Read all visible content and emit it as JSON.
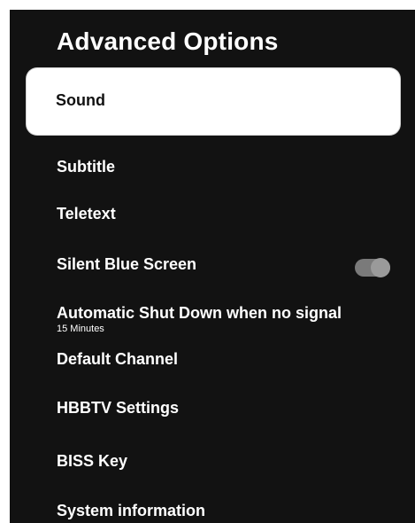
{
  "header": {
    "title": "Advanced Options"
  },
  "menu": {
    "items": [
      {
        "label": "Sound"
      },
      {
        "label": "Subtitle"
      },
      {
        "label": "Teletext"
      },
      {
        "label": "Silent Blue Screen",
        "toggle": "on"
      },
      {
        "label": "Automatic Shut Down when no signal",
        "value": "15 Minutes"
      },
      {
        "label": "Default Channel"
      },
      {
        "label": "HBBTV Settings"
      },
      {
        "label": "BISS Key"
      },
      {
        "label": "System information"
      }
    ]
  },
  "colors": {
    "background": "#121212",
    "text": "#ffffff",
    "selected_bg": "#ffffff",
    "toggle": "#7a7a7a"
  }
}
